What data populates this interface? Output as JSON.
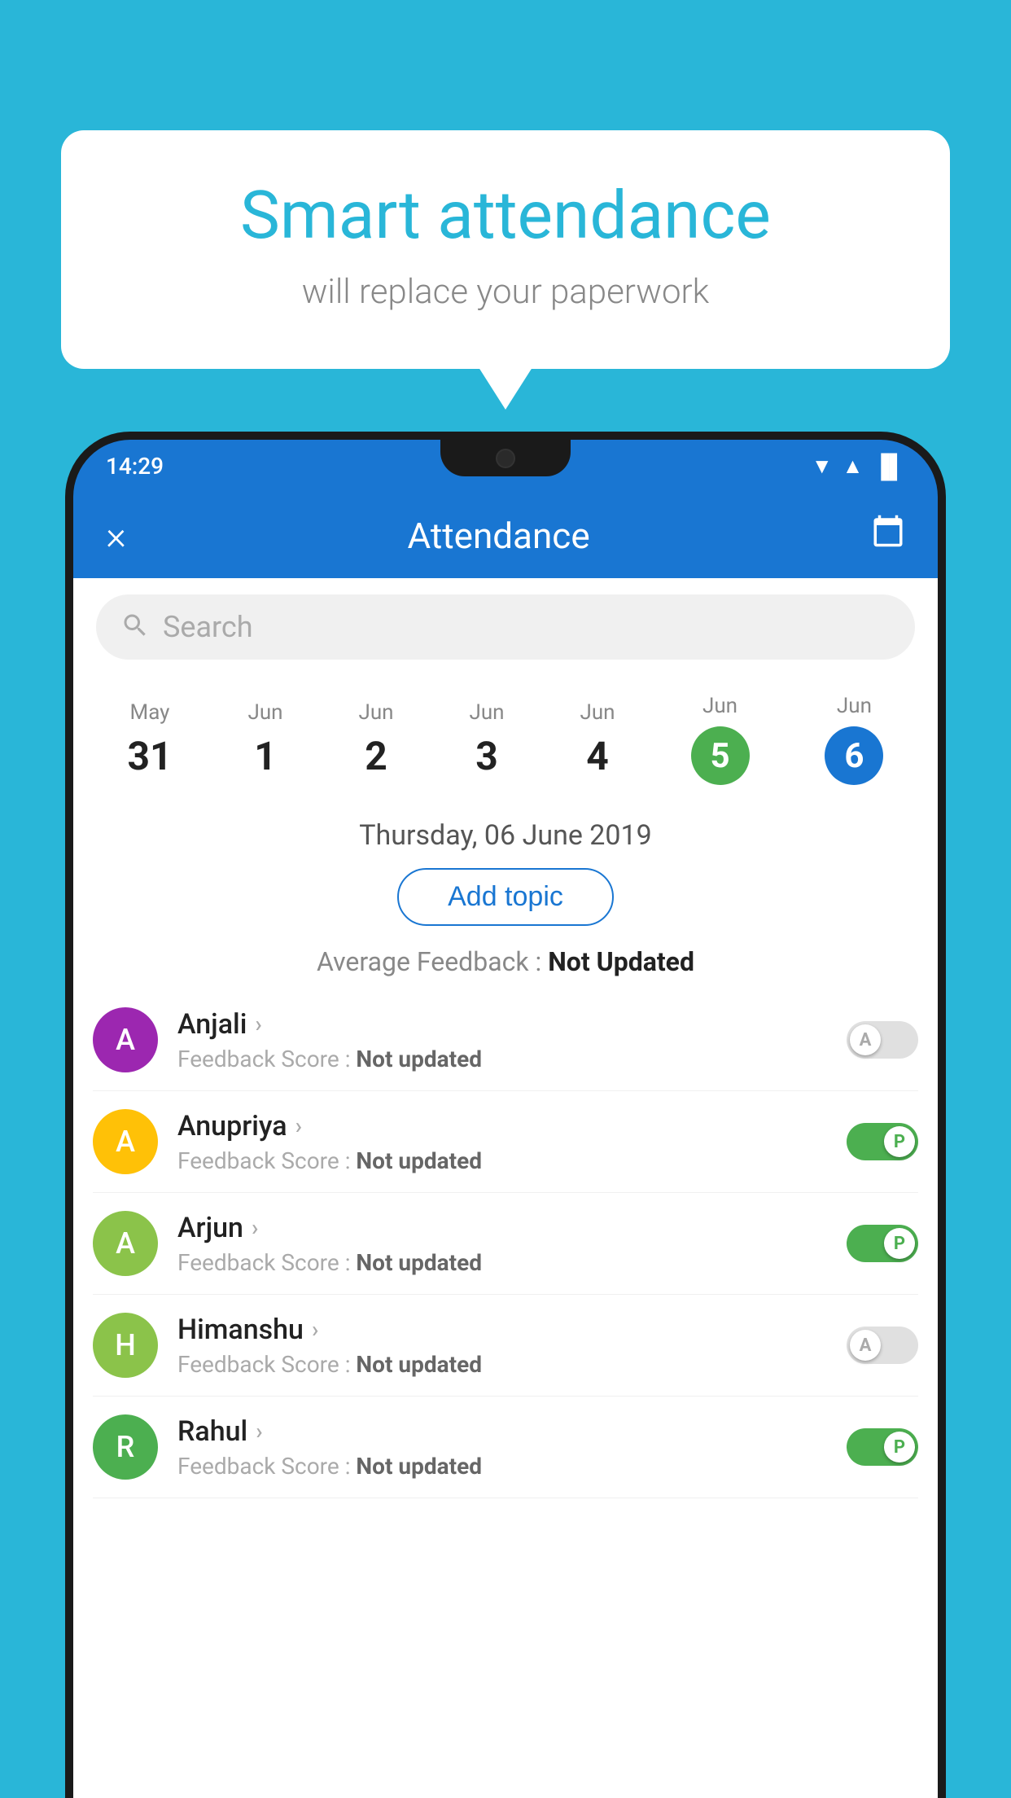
{
  "background_color": "#29b6d8",
  "speech_bubble": {
    "title": "Smart attendance",
    "subtitle": "will replace your paperwork"
  },
  "status_bar": {
    "time": "14:29",
    "wifi": "▼",
    "signal": "▲",
    "battery": "▐"
  },
  "app_bar": {
    "title": "Attendance",
    "close_label": "×",
    "calendar_icon": "calendar"
  },
  "search": {
    "placeholder": "Search"
  },
  "calendar": {
    "days": [
      {
        "month": "May",
        "date": "31",
        "state": "normal"
      },
      {
        "month": "Jun",
        "date": "1",
        "state": "normal"
      },
      {
        "month": "Jun",
        "date": "2",
        "state": "normal"
      },
      {
        "month": "Jun",
        "date": "3",
        "state": "normal"
      },
      {
        "month": "Jun",
        "date": "4",
        "state": "normal"
      },
      {
        "month": "Jun",
        "date": "5",
        "state": "today"
      },
      {
        "month": "Jun",
        "date": "6",
        "state": "selected"
      }
    ]
  },
  "selected_date": "Thursday, 06 June 2019",
  "add_topic_label": "Add topic",
  "feedback_summary": {
    "label": "Average Feedback : ",
    "value": "Not Updated"
  },
  "students": [
    {
      "name": "Anjali",
      "feedback_label": "Feedback Score : ",
      "feedback_value": "Not updated",
      "avatar_letter": "A",
      "avatar_color": "#9c27b0",
      "toggle_state": "off",
      "toggle_label": "A"
    },
    {
      "name": "Anupriya",
      "feedback_label": "Feedback Score : ",
      "feedback_value": "Not updated",
      "avatar_letter": "A",
      "avatar_color": "#ffc107",
      "toggle_state": "on",
      "toggle_label": "P"
    },
    {
      "name": "Arjun",
      "feedback_label": "Feedback Score : ",
      "feedback_value": "Not updated",
      "avatar_letter": "A",
      "avatar_color": "#8bc34a",
      "toggle_state": "on",
      "toggle_label": "P"
    },
    {
      "name": "Himanshu",
      "feedback_label": "Feedback Score : ",
      "feedback_value": "Not updated",
      "avatar_letter": "H",
      "avatar_color": "#8bc34a",
      "toggle_state": "off",
      "toggle_label": "A"
    },
    {
      "name": "Rahul",
      "feedback_label": "Feedback Score : ",
      "feedback_value": "Not updated",
      "avatar_letter": "R",
      "avatar_color": "#4caf50",
      "toggle_state": "on",
      "toggle_label": "P"
    }
  ]
}
